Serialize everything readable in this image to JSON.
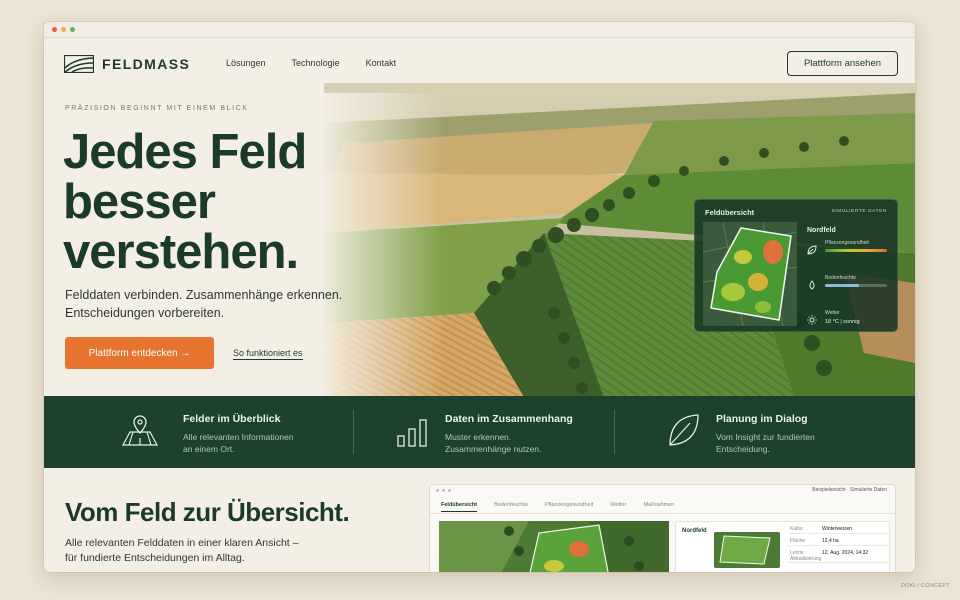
{
  "brand": {
    "name": "FELDMASS"
  },
  "nav": {
    "items": [
      "Lösungen",
      "Technologie",
      "Kontakt"
    ],
    "cta": "Plattform ansehen"
  },
  "hero": {
    "eyebrow": "PRÄZISION BEGINNT MIT EINEM BLICK",
    "headline_lines": [
      "Jedes Feld",
      "besser",
      "verstehen."
    ],
    "subtext": "Felddaten verbinden. Zusammenhänge erkennen. Entscheidungen vorbereiten.",
    "primary_cta": "Plattform entdecken →",
    "secondary_link": "So funktioniert es"
  },
  "overview_card": {
    "title": "Feldübersicht",
    "tag": "SIMULIERTE DATEN",
    "field": "Nordfeld",
    "metrics": [
      {
        "label": "Pflanzengesundheit",
        "icon": "leaf-icon"
      },
      {
        "label": "Bodenfeuchte",
        "icon": "droplet-icon",
        "level": 0.55
      },
      {
        "label": "Wetter",
        "value": "18 °C  |  sonnig",
        "icon": "sun-icon"
      }
    ]
  },
  "features": [
    {
      "title": "Felder im Überblick",
      "desc_lines": [
        "Alle relevanten Informationen",
        "an einem Ort."
      ],
      "icon": "map-pin-icon"
    },
    {
      "title": "Daten im Zusammenhang",
      "desc_lines": [
        "Muster erkennen.",
        "Zusammenhänge nutzen."
      ],
      "icon": "bar-chart-icon"
    },
    {
      "title": "Planung im Dialog",
      "desc_lines": [
        "Vom Insight zur fundierten",
        "Entscheidung."
      ],
      "icon": "leaf-icon"
    }
  ],
  "section": {
    "title": "Vom Feld zur Übersicht.",
    "subtext_lines": [
      "Alle relevanten Felddaten in einer klaren Ansicht –",
      "für fundierte Entscheidungen im Alltag."
    ]
  },
  "preview": {
    "note": "Beispielansicht · Simulierte Daten",
    "tabs": [
      "Feldübersicht",
      "Bodenfeuchte",
      "Pflanzengesundheit",
      "Wetter",
      "Maßnahmen"
    ],
    "field": "Nordfeld",
    "rows": [
      {
        "k": "Kultur",
        "v": "Winterweizen"
      },
      {
        "k": "Fläche",
        "v": "12,4 ha"
      },
      {
        "k": "Letzte Aktualisierung",
        "v": "12. Aug. 2024, 14:32"
      }
    ]
  },
  "credit": "DOKI / CONCEPT",
  "colors": {
    "brand_green": "#1d412c",
    "accent_orange": "#e6742f",
    "background": "#f4efe4"
  }
}
